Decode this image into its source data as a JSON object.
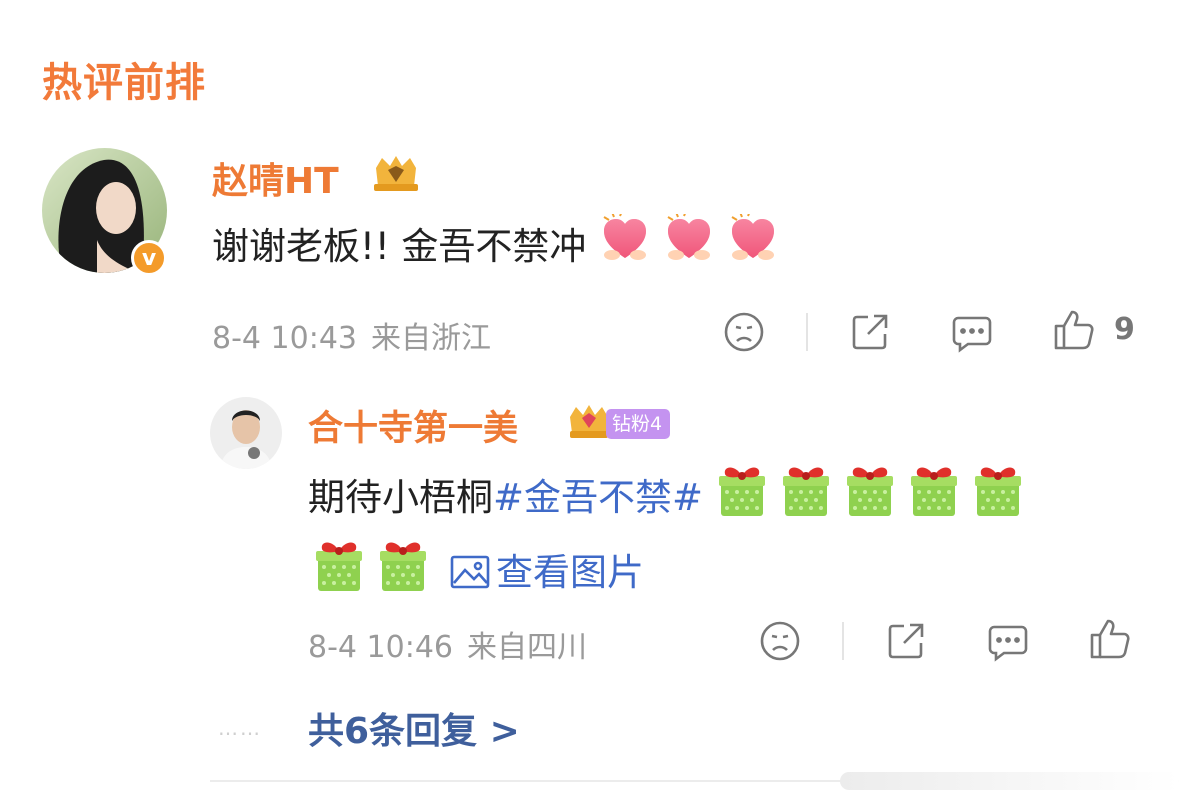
{
  "section_title": "热评前排",
  "comment": {
    "username": "赵晴HT",
    "text": "谢谢老板!! 金吾不禁冲",
    "emojis": [
      "heart-hands-emoji",
      "heart-hands-emoji",
      "heart-hands-emoji"
    ],
    "date": "8-4 10:43",
    "location": "来自浙江",
    "like_count": "9",
    "verified_label": "v"
  },
  "reply": {
    "username": "合十寺第一美",
    "fan_badge": "钻粉4",
    "text_before": "期待小梧桐",
    "topic": "#金吾不禁#",
    "emojis": [
      "gift-emoji",
      "gift-emoji",
      "gift-emoji",
      "gift-emoji",
      "gift-emoji",
      "gift-emoji",
      "gift-emoji"
    ],
    "view_image_label": "查看图片",
    "date": "8-4 10:46",
    "location": "来自四川"
  },
  "more_replies": {
    "dots": "……",
    "label": "共6条回复 >"
  },
  "colors": {
    "accent_orange": "#f27a3a",
    "username_orange": "#ee7a35",
    "link_blue": "#3f6ac8",
    "replies_blue": "#3f5f9c",
    "fan_badge_purple": "#c493f0",
    "meta_gray": "#9a9a9a"
  }
}
